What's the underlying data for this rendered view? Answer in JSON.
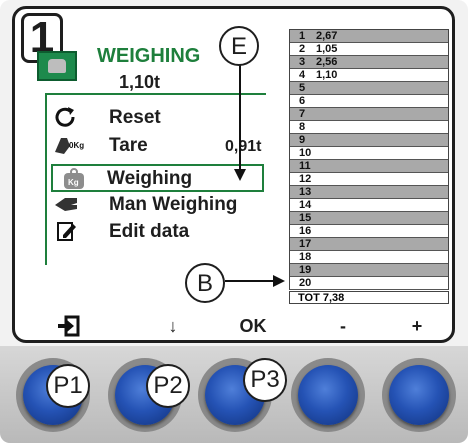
{
  "screen": {
    "number": "1",
    "title": "WEIGHING",
    "main_value": "1,10t"
  },
  "menu": {
    "items": [
      {
        "label": "Reset",
        "icon": "reset-icon"
      },
      {
        "label": "Tare",
        "icon": "tare-icon",
        "icon_text": "0Kg",
        "value": "0,91t"
      },
      {
        "label": "Weighing",
        "icon": "weighing-icon",
        "icon_text": "Kg",
        "selected": true
      },
      {
        "label": "Man Weighing",
        "icon": "hand-icon"
      },
      {
        "label": "Edit data",
        "icon": "edit-icon"
      }
    ]
  },
  "weighings": {
    "rows": [
      {
        "num": "1",
        "value": "2,67"
      },
      {
        "num": "2",
        "value": "1,05"
      },
      {
        "num": "3",
        "value": "2,56"
      },
      {
        "num": "4",
        "value": "1,10"
      },
      {
        "num": "5",
        "value": ""
      },
      {
        "num": "6",
        "value": ""
      },
      {
        "num": "7",
        "value": ""
      },
      {
        "num": "8",
        "value": ""
      },
      {
        "num": "9",
        "value": ""
      },
      {
        "num": "10",
        "value": ""
      },
      {
        "num": "11",
        "value": ""
      },
      {
        "num": "12",
        "value": ""
      },
      {
        "num": "13",
        "value": ""
      },
      {
        "num": "14",
        "value": ""
      },
      {
        "num": "15",
        "value": ""
      },
      {
        "num": "16",
        "value": ""
      },
      {
        "num": "17",
        "value": ""
      },
      {
        "num": "18",
        "value": ""
      },
      {
        "num": "19",
        "value": ""
      },
      {
        "num": "20",
        "value": ""
      }
    ],
    "total": "TOT 7,38"
  },
  "softkeys": {
    "exit_icon": "exit-icon",
    "down": "↓",
    "ok": "OK",
    "minus": "-",
    "plus": "+"
  },
  "annotations": {
    "e": "E",
    "b": "B",
    "p1": "P1",
    "p2": "P2",
    "p3": "P3"
  },
  "colors": {
    "accent_green": "#1e7f3c",
    "list_shade": "#a9a9a9",
    "key_blue": "#2553b5"
  }
}
